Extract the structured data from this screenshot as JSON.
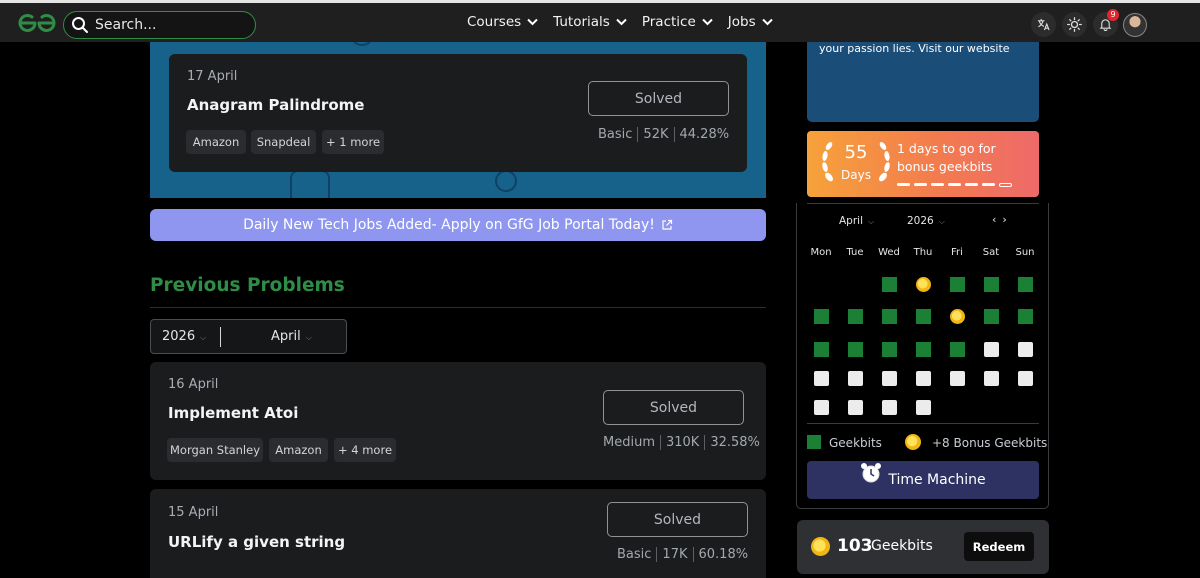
{
  "navbar": {
    "search_placeholder": "Search...",
    "menu": [
      "Courses",
      "Tutorials",
      "Practice",
      "Jobs"
    ],
    "notification_count": "9"
  },
  "featured": {
    "date": "17 April",
    "title": "Anagram Palindrome",
    "tags": [
      "Amazon",
      "Snapdeal",
      "+ 1 more"
    ],
    "status": "Solved",
    "difficulty": "Basic",
    "submissions": "52K",
    "accuracy": "44.28%"
  },
  "jobs_banner": "Daily New Tech Jobs Added- Apply on GfG Job Portal Today!",
  "previous": {
    "heading": "Previous Problems",
    "year": "2026",
    "month": "April",
    "problems": [
      {
        "date": "16 April",
        "title": "Implement Atoi",
        "tags": [
          "Morgan Stanley",
          "Amazon",
          "+ 4 more"
        ],
        "status": "Solved",
        "difficulty": "Medium",
        "submissions": "310K",
        "accuracy": "32.58%"
      },
      {
        "date": "15 April",
        "title": "URLify a given string",
        "tags": [],
        "status": "Solved",
        "difficulty": "Basic",
        "submissions": "17K",
        "accuracy": "60.18%"
      }
    ]
  },
  "sidebar": {
    "info_text": "your passion lies. Visit our website",
    "streak": {
      "days_count": "55",
      "days_label": "Days",
      "message": "1 days to go for bonus geekbits",
      "progress_filled": 6,
      "progress_total": 7
    },
    "calendar": {
      "month": "April",
      "year": "2026",
      "weekdays": [
        "Mon",
        "Tue",
        "Wed",
        "Thu",
        "Fri",
        "Sat",
        "Sun"
      ],
      "rows": [
        [
          "",
          "",
          "g",
          "coin",
          "g",
          "g",
          "g"
        ],
        [
          "g",
          "g",
          "g",
          "g",
          "coin",
          "g",
          "g"
        ],
        [
          "g",
          "g",
          "g",
          "g",
          "g",
          "w",
          "w"
        ],
        [
          "w",
          "w",
          "w",
          "w",
          "w",
          "w",
          "w"
        ],
        [
          "w",
          "w",
          "w",
          "w",
          "",
          "",
          ""
        ]
      ],
      "legend_geekbits": "Geekbits",
      "legend_bonus": "+8 Bonus Geekbits",
      "time_machine": "Time Machine"
    },
    "geekbits": {
      "count": "103",
      "label": "Geekbits",
      "redeem": "Redeem"
    }
  },
  "colors": {
    "brand_green": "#2f8d46",
    "banner_blue": "#17628a",
    "jobs_purple": "#8e96f0",
    "cell_green": "#1b7f35"
  }
}
